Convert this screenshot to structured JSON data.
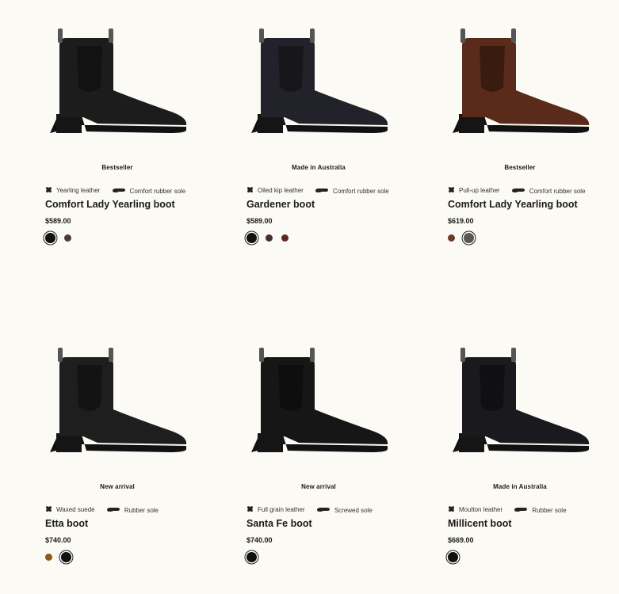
{
  "products": [
    {
      "badge": "Bestseller",
      "feature1": {
        "icon": "leather-hide-icon",
        "label": "Yearling leather"
      },
      "feature2": {
        "icon": "sole-icon",
        "label": "Comfort rubber sole"
      },
      "name": "Comfort Lady Yearling boot",
      "price": "$589.00",
      "boot_color": "#1c1c1c",
      "swatches": [
        {
          "color": "#111111",
          "selected": true
        },
        {
          "color": "#4a3a33",
          "selected": false
        }
      ]
    },
    {
      "badge": "Made in Australia",
      "feature1": {
        "icon": "leather-hide-icon",
        "label": "Oiled kip leather"
      },
      "feature2": {
        "icon": "sole-icon",
        "label": "Comfort rubber sole"
      },
      "name": "Gardener boot",
      "price": "$589.00",
      "boot_color": "#22222a",
      "swatches": [
        {
          "color": "#111111",
          "selected": true
        },
        {
          "color": "#4b2e2a",
          "selected": false
        },
        {
          "color": "#5a2a22",
          "selected": false
        }
      ]
    },
    {
      "badge": "Bestseller",
      "feature1": {
        "icon": "leather-hide-icon",
        "label": "Pull-up leather"
      },
      "feature2": {
        "icon": "sole-icon",
        "label": "Comfort rubber sole"
      },
      "name": "Comfort Lady Yearling boot",
      "price": "$619.00",
      "boot_color": "#5a2a1a",
      "swatches": [
        {
          "color": "#6b3a28",
          "selected": false
        },
        {
          "color": "#5d5550",
          "selected": true
        }
      ]
    },
    {
      "badge": "New arrival",
      "feature1": {
        "icon": "leather-hide-icon",
        "label": "Waxed suede"
      },
      "feature2": {
        "icon": "sole-icon",
        "label": "Rubber sole"
      },
      "name": "Etta boot",
      "price": "$740.00",
      "boot_color": "#1e1e1e",
      "swatches": [
        {
          "color": "#8a5a1a",
          "selected": false
        },
        {
          "color": "#111111",
          "selected": true
        }
      ]
    },
    {
      "badge": "New arrival",
      "feature1": {
        "icon": "leather-hide-icon",
        "label": "Full grain leather"
      },
      "feature2": {
        "icon": "sole-icon",
        "label": "Screwed sole"
      },
      "name": "Santa Fe boot",
      "price": "$740.00",
      "boot_color": "#161616",
      "swatches": [
        {
          "color": "#111111",
          "selected": true
        }
      ]
    },
    {
      "badge": "Made in Australia",
      "feature1": {
        "icon": "leather-hide-icon",
        "label": "Moulton leather"
      },
      "feature2": {
        "icon": "sole-icon",
        "label": "Rubber sole"
      },
      "name": "Millicent boot",
      "price": "$669.00",
      "boot_color": "#1a1a1e",
      "swatches": [
        {
          "color": "#111111",
          "selected": true
        }
      ]
    }
  ]
}
